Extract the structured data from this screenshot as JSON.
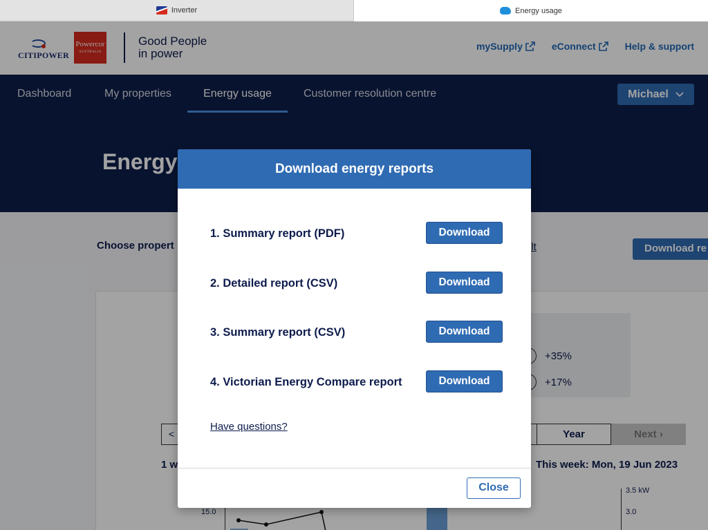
{
  "browser": {
    "tabs": [
      {
        "label": "Inverter",
        "icon": "flag-icon"
      },
      {
        "label": "Energy usage",
        "icon": "cloud-icon"
      }
    ]
  },
  "header": {
    "citipower_logo": "CITIPOWER",
    "powercor_logo": "Powercor",
    "powercor_sub": "AUSTRALIA",
    "tagline_line1": "Good People",
    "tagline_line2": "in power",
    "links": [
      "mySupply",
      "eConnect",
      "Help & support"
    ]
  },
  "nav": {
    "items": [
      "Dashboard",
      "My properties",
      "Energy usage",
      "Customer resolution centre"
    ],
    "active": "Energy usage",
    "user": "Michael"
  },
  "hero": {
    "title": "Energy"
  },
  "content": {
    "choose_label": "Choose propert",
    "set_default": "ult",
    "download_reports": "Download re",
    "stats": [
      "+35%",
      "+17%"
    ],
    "seg_prev": "<",
    "seg_year": "Year",
    "seg_next": "Next",
    "week_left": "1 w",
    "week_right": "This week: Mon, 19 Jun 2023",
    "tick_left": "15.0",
    "tick_right_1": "3.5 kW",
    "tick_right_2": "3.0"
  },
  "modal": {
    "title": "Download energy reports",
    "reports": [
      {
        "label": "1. Summary report (PDF)",
        "button": "Download"
      },
      {
        "label": "2. Detailed report (CSV)",
        "button": "Download"
      },
      {
        "label": "3. Summary report (CSV)",
        "button": "Download"
      },
      {
        "label": "4. Victorian Energy Compare report",
        "button": "Download"
      }
    ],
    "questions_link": "Have questions?",
    "close_label": "Close"
  },
  "colors": {
    "navy": "#0d1e4a",
    "primary_blue": "#2f6bb3",
    "link_blue": "#2168b5",
    "powercor_red": "#d52b1e"
  }
}
